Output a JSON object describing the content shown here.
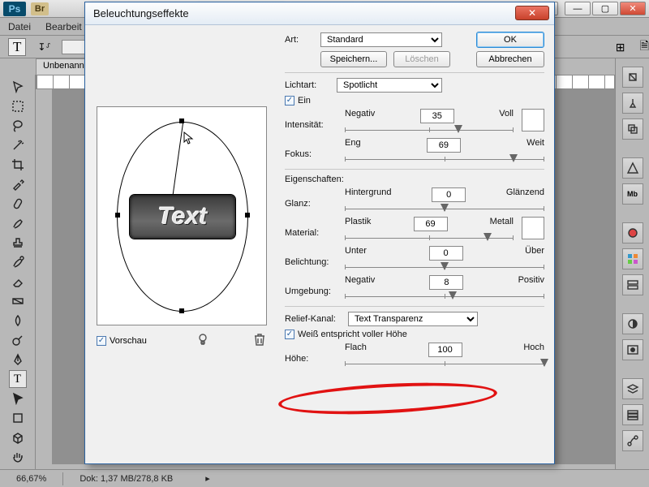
{
  "host": {
    "ps_badge": "Ps",
    "br_badge": "Br",
    "menu": {
      "file": "Datei",
      "edit": "Bearbeit"
    },
    "win_controls": {
      "minimize": "—",
      "maximize": "▢",
      "close": "✕"
    },
    "win_controls_inner": {
      "minimize": "—",
      "restore": "❐",
      "close": "✕"
    },
    "options": {
      "tool_glyph": "T",
      "arrange_glyph": "⊞",
      "doc_icon": "🗎"
    },
    "doc_tab": "Unbenann",
    "status": {
      "zoom": "66,67%",
      "docinfo": "Dok: 1,37 MB/278,8 KB",
      "expand": "▸"
    },
    "tool_char": "T"
  },
  "dialog": {
    "title": "Beleuchtungseffekte",
    "close_glyph": "✕",
    "ok": "OK",
    "cancel": "Abbrechen",
    "style_label": "Art:",
    "style_value": "Standard",
    "save": "Speichern...",
    "delete": "Löschen",
    "preview_text": "Text",
    "preview_checkbox": "Vorschau",
    "light_type_label": "Lichtart:",
    "light_type_value": "Spotlicht",
    "on_checkbox": "Ein",
    "sliders": {
      "intensity": {
        "label": "Intensität:",
        "left": "Negativ",
        "right": "Voll",
        "value": 35,
        "min": -100,
        "max": 100
      },
      "focus": {
        "label": "Fokus:",
        "left": "Eng",
        "right": "Weit",
        "value": 69,
        "min": -100,
        "max": 100
      },
      "gloss": {
        "label": "Glanz:",
        "left": "Hintergrund",
        "right": "Glänzend",
        "value": 0,
        "min": -100,
        "max": 100
      },
      "material": {
        "label": "Material:",
        "left": "Plastik",
        "right": "Metall",
        "value": 69,
        "min": -100,
        "max": 100
      },
      "exposure": {
        "label": "Belichtung:",
        "left": "Unter",
        "right": "Über",
        "value": 0,
        "min": -100,
        "max": 100
      },
      "ambience": {
        "label": "Umgebung:",
        "left": "Negativ",
        "right": "Positiv",
        "value": 8,
        "min": -100,
        "max": 100
      },
      "height": {
        "label": "Höhe:",
        "left": "Flach",
        "right": "Hoch",
        "value": 100,
        "min": 0,
        "max": 100
      }
    },
    "properties_title": "Eigenschaften:",
    "texture_label": "Relief-Kanal:",
    "texture_value": "Text Transparenz",
    "white_high": "Weiß entspricht voller Höhe"
  }
}
